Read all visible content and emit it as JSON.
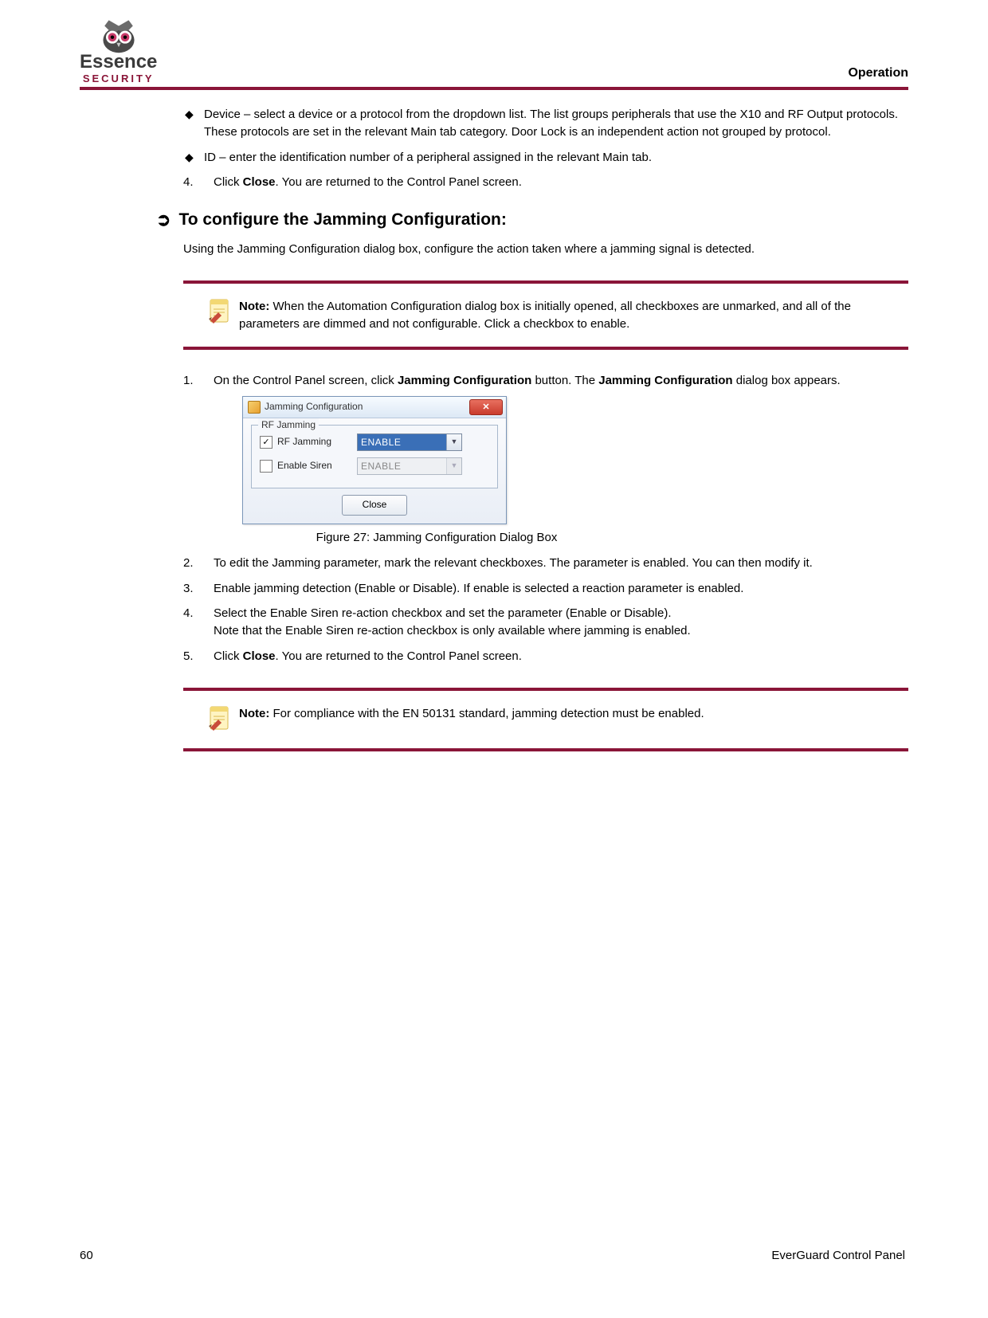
{
  "header": {
    "section_title": "Operation",
    "logo_text": "Essence",
    "logo_sub": "SECURITY"
  },
  "bullets": {
    "device": "Device – select a device or a protocol from the dropdown list. The list groups peripherals that use the X10 and RF Output protocols. These protocols are set in the relevant Main tab category. Door Lock is an independent action not grouped by protocol.",
    "id": "ID – enter the identification number of a peripheral assigned in the relevant Main tab."
  },
  "steps_top": {
    "n4": "4.",
    "s4_pre": "Click ",
    "s4_bold": "Close",
    "s4_post": ". You are returned to the Control Panel screen."
  },
  "proc": {
    "arrow": "➲",
    "title": "To configure the Jamming Configuration:"
  },
  "intro": "Using the Jamming Configuration dialog box, configure the action taken where a jamming signal is detected.",
  "note1": {
    "label": "Note:",
    "text": " When the Automation Configuration dialog box is initially opened, all checkboxes are unmarked, and all of the parameters are dimmed and not configurable. Click a checkbox to enable."
  },
  "steps": {
    "n1": "1.",
    "s1_pre": "On the Control Panel screen, click ",
    "s1_b1": "Jamming Configuration",
    "s1_mid": " button. The ",
    "s1_b2": "Jamming Configuration",
    "s1_post": " dialog box appears.",
    "n2": "2.",
    "s2": "To edit the Jamming parameter, mark the relevant checkboxes. The parameter is enabled. You can then modify it.",
    "n3": "3.",
    "s3": "Enable jamming detection (Enable or Disable). If enable is selected a reaction parameter is enabled.",
    "n4": "4.",
    "s4": "Select the Enable Siren re-action checkbox and set the parameter (Enable or Disable).\nNote that the Enable Siren re-action checkbox is only available where jamming is enabled.",
    "n5": "5.",
    "s5_pre": "Click ",
    "s5_bold": "Close",
    "s5_post": ". You are returned to the Control Panel screen."
  },
  "dialog": {
    "title": "Jamming Configuration",
    "close_x": "✕",
    "group_legend": "RF Jamming",
    "row1_check": "✓",
    "row1_label": "RF Jamming",
    "row1_value": "ENABLE",
    "row2_check": "",
    "row2_label": "Enable Siren",
    "row2_value": "ENABLE",
    "close_btn": "Close",
    "dropdown_arrow": "▼"
  },
  "figure_caption": "Figure 27: Jamming Configuration Dialog Box",
  "note2": {
    "label": "Note:",
    "text": " For compliance with the EN 50131 standard, jamming detection must be enabled."
  },
  "footer": {
    "page": "60",
    "doc": "EverGuard Control Panel"
  }
}
